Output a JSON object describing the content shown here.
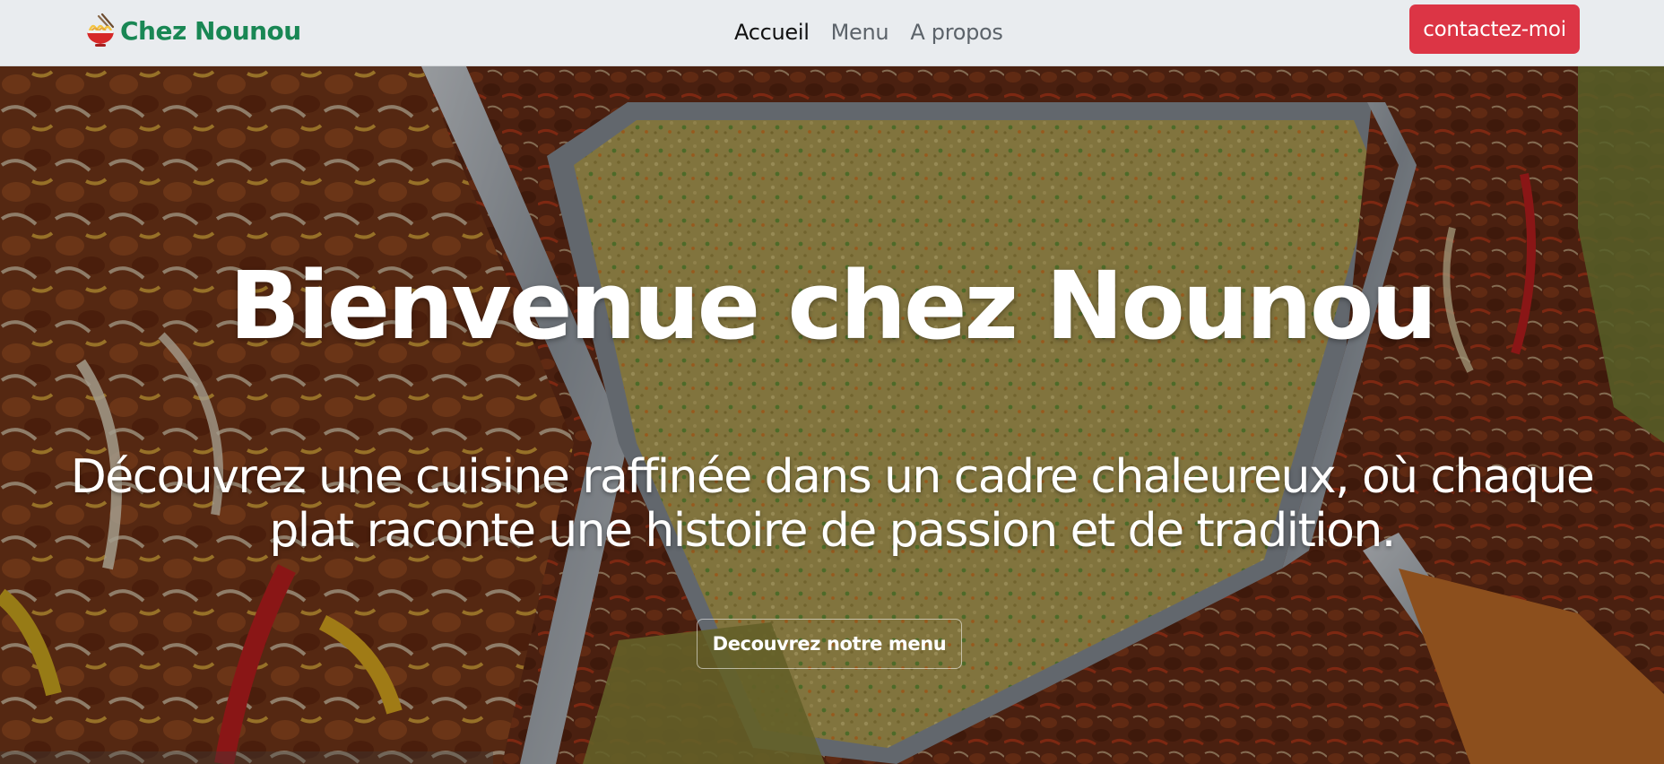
{
  "brand": {
    "name": "Chez Nounou",
    "icon": "noodle-bowl-icon"
  },
  "nav": {
    "items": [
      {
        "label": "Accueil",
        "active": true
      },
      {
        "label": "Menu",
        "active": false
      },
      {
        "label": "A propos",
        "active": false
      }
    ],
    "cta_label": "contactez-moi"
  },
  "hero": {
    "title": "Bienvenue chez Nounou",
    "subtitle_line1": "Découvrez une cuisine raffinée dans un cadre chaleureux, où chaque",
    "subtitle_line2": "plat raconte une histoire de passion et de tradition.",
    "button_label": "Decouvrez notre menu"
  },
  "colors": {
    "navbar_bg": "#e9ecef",
    "brand": "#198754",
    "cta": "#dc3545"
  }
}
